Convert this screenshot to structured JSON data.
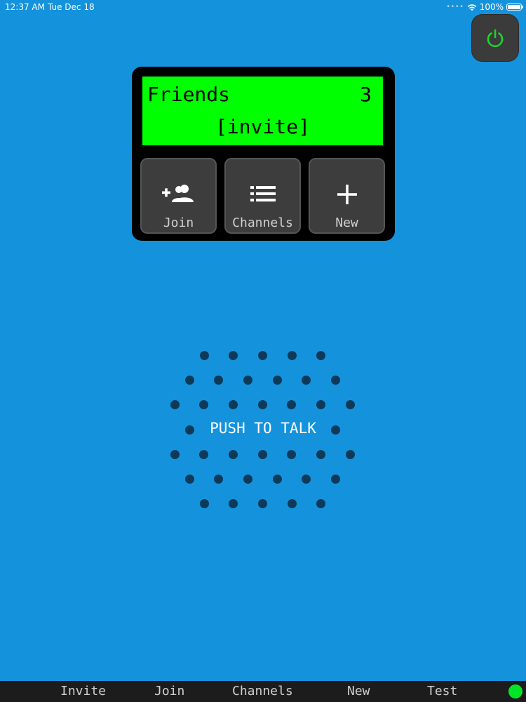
{
  "status_bar": {
    "time": "12:37 AM",
    "date": "Tue Dec 18",
    "battery": "100%"
  },
  "colors": {
    "background": "#1592dc",
    "lcd": "#00ff00",
    "power_icon": "#19d62a",
    "status_led": "#00e626",
    "speaker_dots": "#0e3a5a"
  },
  "lcd": {
    "channel_name": "Friends",
    "count": "3",
    "invite": "[invite]"
  },
  "buttons": {
    "join": {
      "label": "Join",
      "icon": "person-add-icon"
    },
    "channels": {
      "label": "Channels",
      "icon": "list-icon"
    },
    "new": {
      "label": "New",
      "icon": "plus-icon"
    }
  },
  "power": {
    "icon": "power-icon"
  },
  "ptt": {
    "label": "PUSH TO TALK"
  },
  "bottom_bar": {
    "items": [
      "Invite",
      "Join",
      "Channels",
      "New",
      "Test"
    ]
  }
}
